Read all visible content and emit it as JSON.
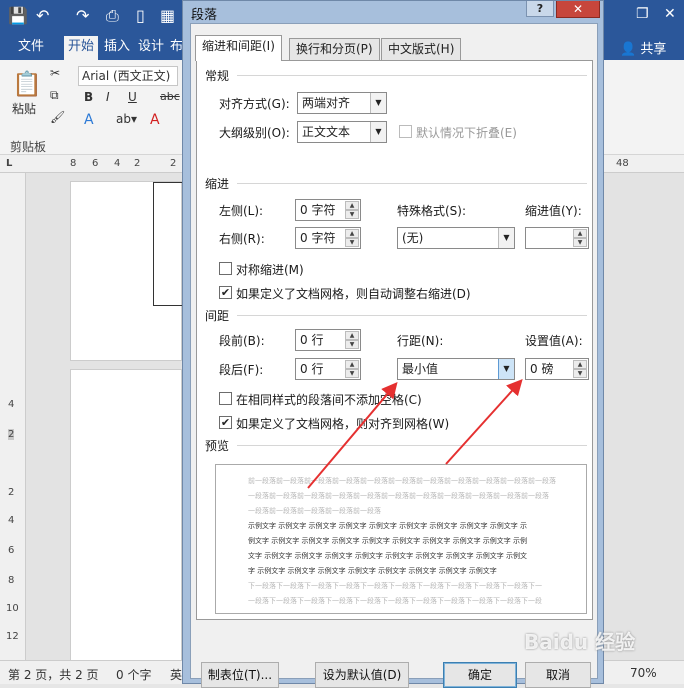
{
  "word": {
    "tabs": [
      "文件",
      "开始",
      "插入",
      "设计",
      "布"
    ],
    "active_tab": "开始",
    "share": "共享",
    "font_name": "Arial (西文正文)",
    "paste_label": "粘贴",
    "clipboard_label": "剪贴板",
    "ruler_left": [
      "8",
      "6",
      "4",
      "2",
      "2"
    ],
    "ruler_right": "48",
    "vruler": [
      "4",
      "2",
      "2",
      "4",
      "6",
      "8",
      "10",
      "12"
    ],
    "status": {
      "page": "第 2 页，共 2 页",
      "words": "0 个字",
      "lang": "英",
      "zoom": "70%"
    }
  },
  "dialog": {
    "title": "段落",
    "help": "?",
    "close": "✕",
    "tabs": [
      "缩进和间距(I)",
      "换行和分页(P)",
      "中文版式(H)"
    ],
    "general": {
      "heading": "常规",
      "align_label": "对齐方式(G):",
      "align_value": "两端对齐",
      "outline_label": "大纲级别(O):",
      "outline_value": "正文文本",
      "collapse_label": "默认情况下折叠(E)"
    },
    "indent": {
      "heading": "缩进",
      "left_label": "左侧(L):",
      "left_value": "0 字符",
      "right_label": "右侧(R):",
      "right_value": "0 字符",
      "special_label": "特殊格式(S):",
      "special_value": "(无)",
      "indent_by_label": "缩进值(Y):",
      "indent_by_value": "",
      "mirror_label": "对称缩进(M)",
      "auto_right_label": "如果定义了文档网格，则自动调整右缩进(D)"
    },
    "spacing": {
      "heading": "间距",
      "before_label": "段前(B):",
      "before_value": "0 行",
      "after_label": "段后(F):",
      "after_value": "0 行",
      "line_label": "行距(N):",
      "line_value": "最小值",
      "at_label": "设置值(A):",
      "at_value": "0 磅",
      "no_space_label": "在相同样式的段落间不添加空格(C)",
      "snap_grid_label": "如果定义了文档网格，则对齐到网格(W)"
    },
    "preview": {
      "heading": "预览",
      "prev_lines": [
        "前一段落前一段落前一段落前一段落前一段落前一段落前一段落前一段落前一段落前一段落前一段落",
        "一段落前一段落前一段落前一段落前一段落前一段落前一段落前一段落前一段落前一段落前一段落",
        "一段落前一段落前一段落前一段落前一段落"
      ],
      "sample_lines": [
        "示例文字 示例文字 示例文字 示例文字 示例文字 示例文字 示例文字 示例文字 示例文字 示",
        "例文字 示例文字 示例文字 示例文字 示例文字 示例文字 示例文字 示例文字 示例文字 示例",
        "文字 示例文字 示例文字 示例文字 示例文字 示例文字 示例文字 示例文字 示例文字 示例文",
        "字 示例文字 示例文字 示例文字 示例文字 示例文字 示例文字 示例文字 示例文字"
      ],
      "next_lines": [
        "下一段落下一段落下一段落下一段落下一段落下一段落下一段落下一段落下一段落下一段落下一",
        "一段落下一段落下一段落下一段落下一段落下一段落下一段落下一段落下一段落下一段落下一段",
        "一段落下一段落下一段落下一段落下一段落下一段落下一段落下一段落下一段落下一段落下一段",
        "一段落下一段落下一段落下一段落下一段落下一段落下一段落下一段落下一段落下一段落下一段"
      ]
    },
    "buttons": {
      "tabs": "制表位(T)...",
      "default": "设为默认值(D)",
      "ok": "确定",
      "cancel": "取消"
    }
  },
  "watermark": "Baidu 经验"
}
